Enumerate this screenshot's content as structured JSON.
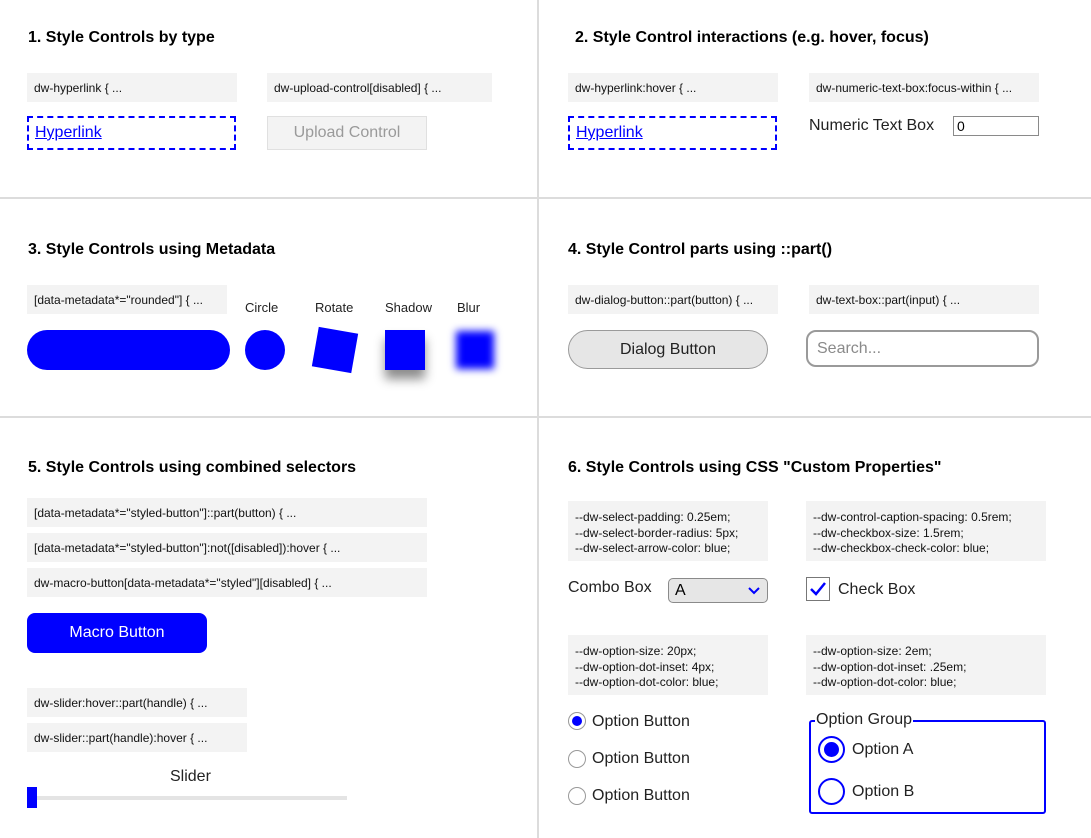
{
  "colors": {
    "accent": "#0000ff",
    "divider": "#dcdcdc",
    "code_bg": "#f3f3f3"
  },
  "section1": {
    "heading": "1. Style Controls by type",
    "code_hyperlink": "dw-hyperlink { ...",
    "code_upload": "dw-upload-control[disabled] { ...",
    "hyperlink": "Hyperlink",
    "upload": "Upload Control"
  },
  "section2": {
    "heading": "2. Style Control interactions (e.g. hover, focus)",
    "code_hyperlink_hover": "dw-hyperlink:hover { ...",
    "code_numeric_focus": "dw-numeric-text-box:focus-within { ...",
    "hyperlink": "Hyperlink",
    "numeric_label": "Numeric Text Box",
    "numeric_value": "0"
  },
  "section3": {
    "heading": "3. Style Controls using Metadata",
    "code_rounded": "[data-metadata*=\"rounded\"] { ...",
    "circle_label": "Circle",
    "rotate_label": "Rotate",
    "shadow_label": "Shadow",
    "blur_label": "Blur"
  },
  "section4": {
    "heading": "4. Style Control parts using ::part()",
    "code_dialog": "dw-dialog-button::part(button) { ...",
    "code_textbox": "dw-text-box::part(input) { ...",
    "dialog_button": "Dialog Button",
    "search_placeholder": "Search..."
  },
  "section5": {
    "heading": "5. Style Controls using combined selectors",
    "code_lines": [
      "[data-metadata*=\"styled-button\"]::part(button) { ...",
      "[data-metadata*=\"styled-button\"]:not([disabled]):hover { ...",
      "dw-macro-button[data-metadata*=\"styled\"][disabled] { ..."
    ],
    "macro_button": "Macro Button",
    "slider_code": [
      "dw-slider:hover::part(handle) { ...",
      "dw-slider::part(handle):hover { ..."
    ],
    "slider_label": "Slider",
    "slider_value_fraction": 0
  },
  "section6": {
    "heading": "6. Style Controls using CSS \"Custom Properties\"",
    "code_select": "--dw-select-padding: 0.25em;\n--dw-select-border-radius: 5px;\n--dw-select-arrow-color: blue;",
    "code_checkbox": "--dw-control-caption-spacing: 0.5rem;\n--dw-checkbox-size: 1.5rem;\n--dw-checkbox-check-color: blue;",
    "combo_label": "Combo Box",
    "combo_value": "A",
    "checkbox_label": "Check Box",
    "checkbox_checked": true,
    "code_option": "--dw-option-size: 20px;\n--dw-option-dot-inset: 4px;\n--dw-option-dot-color: blue;",
    "code_option_group": "--dw-option-size: 2em;\n--dw-option-dot-inset: .25em;\n--dw-option-dot-color: blue;",
    "option_buttons": [
      "Option Button",
      "Option Button",
      "Option Button"
    ],
    "option_selected_index": 0,
    "option_group_legend": "Option Group",
    "option_group_items": [
      "Option A",
      "Option B"
    ],
    "option_group_selected_index": 0
  }
}
